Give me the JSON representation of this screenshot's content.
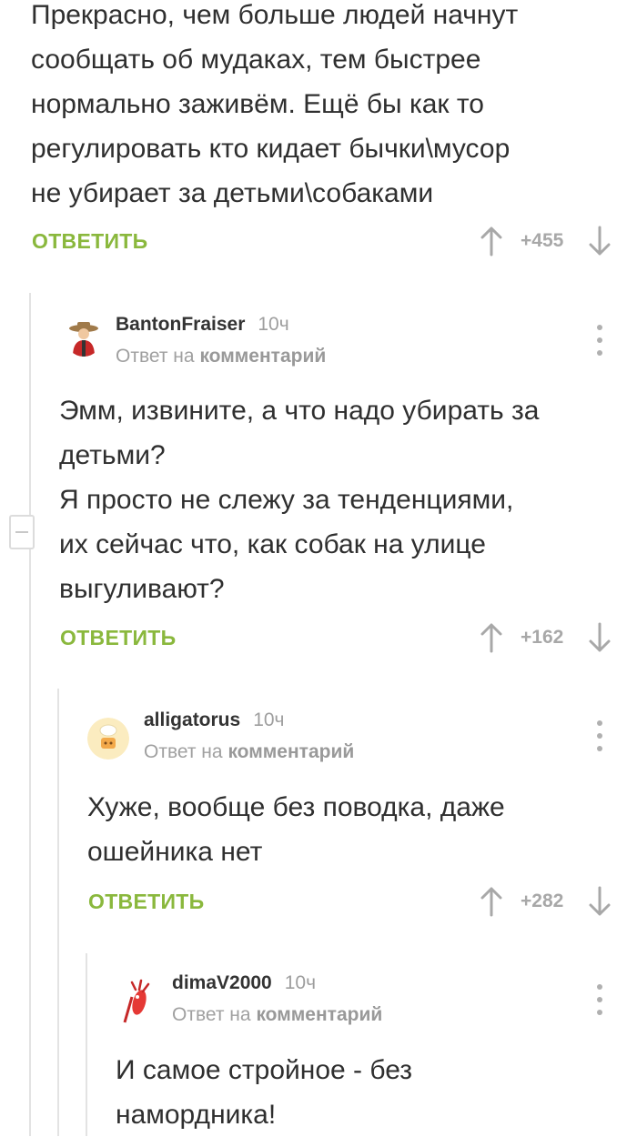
{
  "comments": [
    {
      "body": "Прекрасно, чем больше людей начнут\nсообщать об мудаках, тем быстрее\nнормально заживём. Ещё бы как то\nрегулировать кто кидает бычки\\мусор\nне убирает за детьми\\собаками",
      "reply_label": "ОТВЕТИТЬ",
      "score": "+455"
    },
    {
      "author": "BantonFraiser",
      "time": "10ч",
      "reply_to_prefix": "Ответ на",
      "reply_to_link": "комментарий",
      "body": "Эмм, извините, а что надо убирать за\nдетьми?\nЯ просто не слежу за тенденциями,\nих сейчас что, как собак на улице\nвыгуливают?",
      "reply_label": "ОТВЕТИТЬ",
      "score": "+162"
    },
    {
      "author": "alligatorus",
      "time": "10ч",
      "reply_to_prefix": "Ответ на",
      "reply_to_link": "комментарий",
      "body": "Хуже, вообще без поводка, даже\nошейника нет",
      "reply_label": "ОТВЕТИТЬ",
      "score": "+282"
    },
    {
      "author": "dimaV2000",
      "time": "10ч",
      "reply_to_prefix": "Ответ на",
      "reply_to_link": "комментарий",
      "body": "И самое стройное - без\nнамордника!"
    }
  ],
  "colors": {
    "reply": "#8ab83d",
    "thread_line": "#e3e3e3",
    "score": "#a8a8a8"
  }
}
